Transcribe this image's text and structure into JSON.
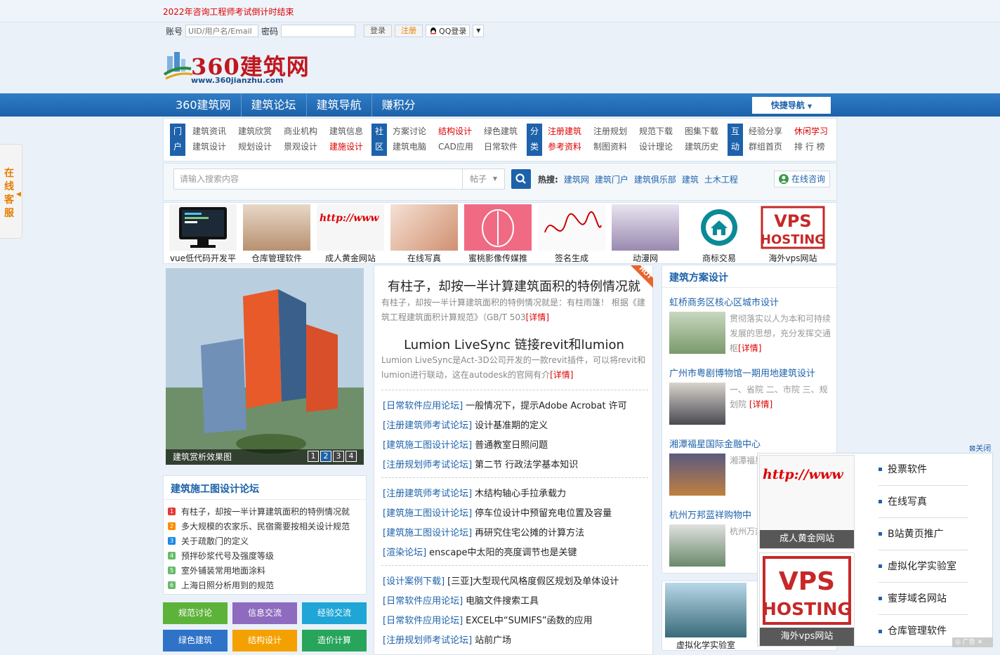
{
  "top": {
    "countdown": "2022年咨询工程师考试倒计时结束",
    "account_label": "账号",
    "account_placeholder": "UID/用户名/Email",
    "password_label": "密码",
    "login_btn": "登录",
    "register_btn": "注册",
    "qq_login": "QQ登录"
  },
  "logo": {
    "text": "360建筑网",
    "url_text": "www.360jianzhu.com"
  },
  "nav": {
    "items": [
      "360建筑网",
      "建筑论坛",
      "建筑导航",
      "赚积分"
    ],
    "quick_nav": "快捷导航"
  },
  "categories": [
    {
      "label": "门户",
      "items": [
        "建筑资讯",
        "建筑欣赏",
        "商业机构",
        "建筑信息",
        "建筑设计",
        "规划设计",
        "景观设计",
        "建施设计"
      ]
    },
    {
      "label": "社区",
      "items": [
        "方案讨论",
        "结构设计",
        "绿色建筑",
        "",
        "建筑电脑",
        "CAD应用",
        "日常软件",
        ""
      ]
    },
    {
      "label": "分类",
      "items": [
        "注册建筑",
        "注册规划",
        "规范下载",
        "图集下载",
        "参考资料",
        "制图资料",
        "设计理论",
        "建筑历史"
      ]
    },
    {
      "label": "互动",
      "items": [
        "经验分享",
        "休闲学习",
        "",
        "",
        "群组首页",
        "排 行 榜",
        "",
        ""
      ]
    }
  ],
  "search": {
    "placeholder": "请输入搜索内容",
    "scope": "帖子",
    "hot_label": "热搜:",
    "hot_terms": [
      "建筑网",
      "建筑门户",
      "建筑俱乐部",
      "建筑",
      "土木工程"
    ],
    "consult": "在线咨询"
  },
  "ads": [
    "vue低代码开发平",
    "仓库管理软件",
    "成人黄金网站",
    "在线写真",
    "蜜桃影像传媒推",
    "签名生成",
    "动漫网",
    "商标交易",
    "海外vps网站"
  ],
  "slideshow": {
    "caption": "建筑赏析效果图",
    "pages": [
      "1",
      "2",
      "3",
      "4"
    ],
    "active": "2"
  },
  "left_forum": {
    "title": "建筑施工图设计论坛",
    "items": [
      "有柱子，却按一半计算建筑面积的特例情况就",
      "多大规模的农家乐、民宿需要按相关设计规范",
      "关于疏散门的定义",
      "预拌砂浆代号及强度等级",
      "室外铺装常用地面涂料",
      "上海日照分析用到的规范"
    ],
    "nums": [
      "1",
      "2",
      "3",
      "4",
      "5",
      "6"
    ]
  },
  "tags": [
    "规范讨论",
    "信息交流",
    "经验交流",
    "绿色建筑",
    "结构设计",
    "造价计算"
  ],
  "center": {
    "head1": "有柱子，却按一半计算建筑面积的特例情况就",
    "sum1": "有柱子，却按一半计算建筑面积的特例情况就是：有柱雨篷！ 根据《建筑工程建筑面积计算规范》（GB/T 503",
    "head2": "Lumion LiveSync 链接revit和lumion",
    "sum2": "Lumion LiveSync是Act-3D公司开发的一款revit插件，可以将revit和lumion进行联动，这在autodesk的官网有介",
    "detail": "[详情]",
    "hot": "HOT",
    "list": [
      {
        "c": "[日常软件应用论坛]",
        "t": "一般情况下，提示Adobe Acrobat 许可"
      },
      {
        "c": "[注册建筑师考试论坛]",
        "t": "设计基准期的定义"
      },
      {
        "c": "[建筑施工图设计论坛]",
        "t": "普通教室日照问题"
      },
      {
        "c": "[注册规划师考试论坛]",
        "t": "第二节 行政法学基本知识"
      },
      {
        "c": "[注册建筑师考试论坛]",
        "t": "木结构轴心手拉承载力"
      },
      {
        "c": "[建筑施工图设计论坛]",
        "t": "停车位设计中预留充电位置及容量"
      },
      {
        "c": "[建筑施工图设计论坛]",
        "t": "再研究住宅公摊的计算方法"
      },
      {
        "c": "[渲染论坛]",
        "t": "enscape中太阳的亮度调节也是关键"
      },
      {
        "c": "[设计案例下载]",
        "t": "[三亚]大型现代风格度假区规划及单体设计"
      },
      {
        "c": "[日常软件应用论坛]",
        "t": "电脑文件搜索工具"
      },
      {
        "c": "[日常软件应用论坛]",
        "t": "EXCEL中“SUMIFS”函数的应用"
      },
      {
        "c": "[注册规划师考试论坛]",
        "t": "站前广场"
      }
    ]
  },
  "right": {
    "title": "建筑方案设计",
    "projects": [
      {
        "t": "虹桥商务区核心区城市设计",
        "d": "贯彻落实以人为本和可持续发展的思想，充分发挥交通枢"
      },
      {
        "t": "广州市粤剧博物馆一期用地建筑设计",
        "d": "一、省院 二、市院 三、规划院 "
      },
      {
        "t": "湘潭福星国际金融中心",
        "d": "湘潭福星国际"
      },
      {
        "t": "杭州万邦蓝祥购物中",
        "d": "杭州万邦同性消费"
      }
    ],
    "detail": "[详情]",
    "lab_caption": "虚拟化学实验室"
  },
  "kefu": "在线客服",
  "float_ad": {
    "close": "关闭",
    "img1_caption": "成人黄金网站",
    "img2_caption": "海外vps网站",
    "links": [
      "投票软件",
      "在线写真",
      "B站黄页推广",
      "虚拟化学实验室",
      "蜜芽域名网站",
      "仓库管理软件"
    ],
    "ad_label": "广告"
  },
  "colors": {
    "nav_blue": "#1d62aa",
    "accent_red": "#dd0000",
    "accent_orange": "#e67e00"
  }
}
